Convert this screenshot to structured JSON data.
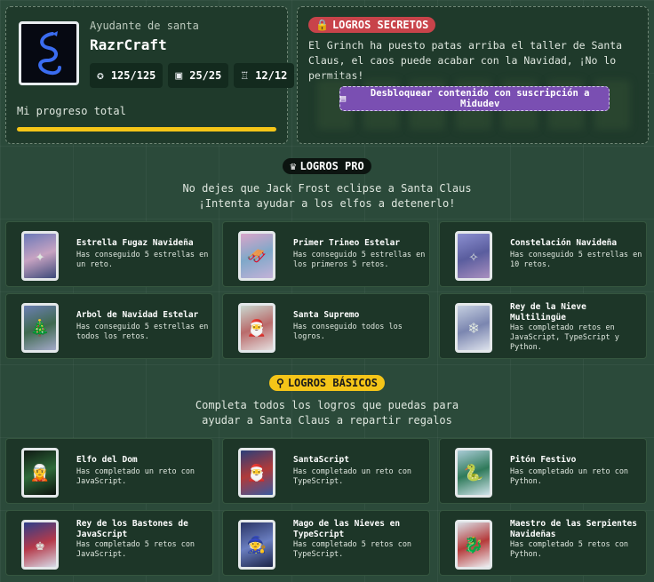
{
  "profile": {
    "role": "Ayudante de santa",
    "username": "RazrCraft",
    "stats": [
      {
        "icon": "star-icon",
        "value": "125/125"
      },
      {
        "icon": "gift-icon",
        "value": "25/25"
      },
      {
        "icon": "trophy-icon",
        "value": "12/12"
      }
    ],
    "progress_label": "Mi progreso total",
    "progress": 1.0
  },
  "secret": {
    "badge": "LOGROS SECRETOS",
    "text": "El Grinch ha puesto patas arriba el taller de Santa Claus, el caos puede acabar con la Navidad, ¡No lo permitas!",
    "unlock_label": "Desbloquear contenido con suscripción a Midudev"
  },
  "pro": {
    "badge": "LOGROS PRO",
    "line1": "No dejes que Jack Frost eclipse a Santa Claus",
    "line2": "¡Intenta ayudar a los elfos a detenerlo!",
    "cards": [
      {
        "title": "Estrella Fugaz Navideña",
        "desc": "Has conseguido 5 estrellas en un reto."
      },
      {
        "title": "Primer Trineo Estelar",
        "desc": "Has conseguido 5 estrellas en los primeros 5 retos."
      },
      {
        "title": "Constelación Navideña",
        "desc": "Has conseguido 5 estrellas en 10 retos."
      },
      {
        "title": "Arbol de Navidad Estelar",
        "desc": "Has conseguido 5 estrellas en todos los retos."
      },
      {
        "title": "Santa Supremo",
        "desc": "Has conseguido todos los logros."
      },
      {
        "title": "Rey de la Nieve Multilingüe",
        "desc": "Has completado retos en JavaScript, TypeScript y Python."
      }
    ]
  },
  "basic": {
    "badge": "LOGROS BÁSICOS",
    "line1": "Completa todos los logros que puedas para",
    "line2": "ayudar a Santa Claus a repartir regalos",
    "cards": [
      {
        "title": "Elfo del Dom",
        "desc": "Has completado un reto con JavaScript."
      },
      {
        "title": "SantaScript",
        "desc": "Has completado un reto con TypeScript."
      },
      {
        "title": "Pitón Festivo",
        "desc": "Has completado un reto con Python."
      },
      {
        "title": "Rey de los Bastones de JavaScript",
        "desc": "Has completado 5 retos con JavaScript."
      },
      {
        "title": "Mago de las Nieves en TypeScript",
        "desc": "Has completado 5 retos con TypeScript."
      },
      {
        "title": "Maestro de las Serpientes Navideñas",
        "desc": "Has completado 5 retos con Python."
      }
    ]
  },
  "colors": {
    "background": "#2b4a3a",
    "panel": "#1f3a2b",
    "accent_yellow": "#f5c518",
    "accent_red": "#c8434a",
    "accent_purple": "#7a4fb2"
  }
}
